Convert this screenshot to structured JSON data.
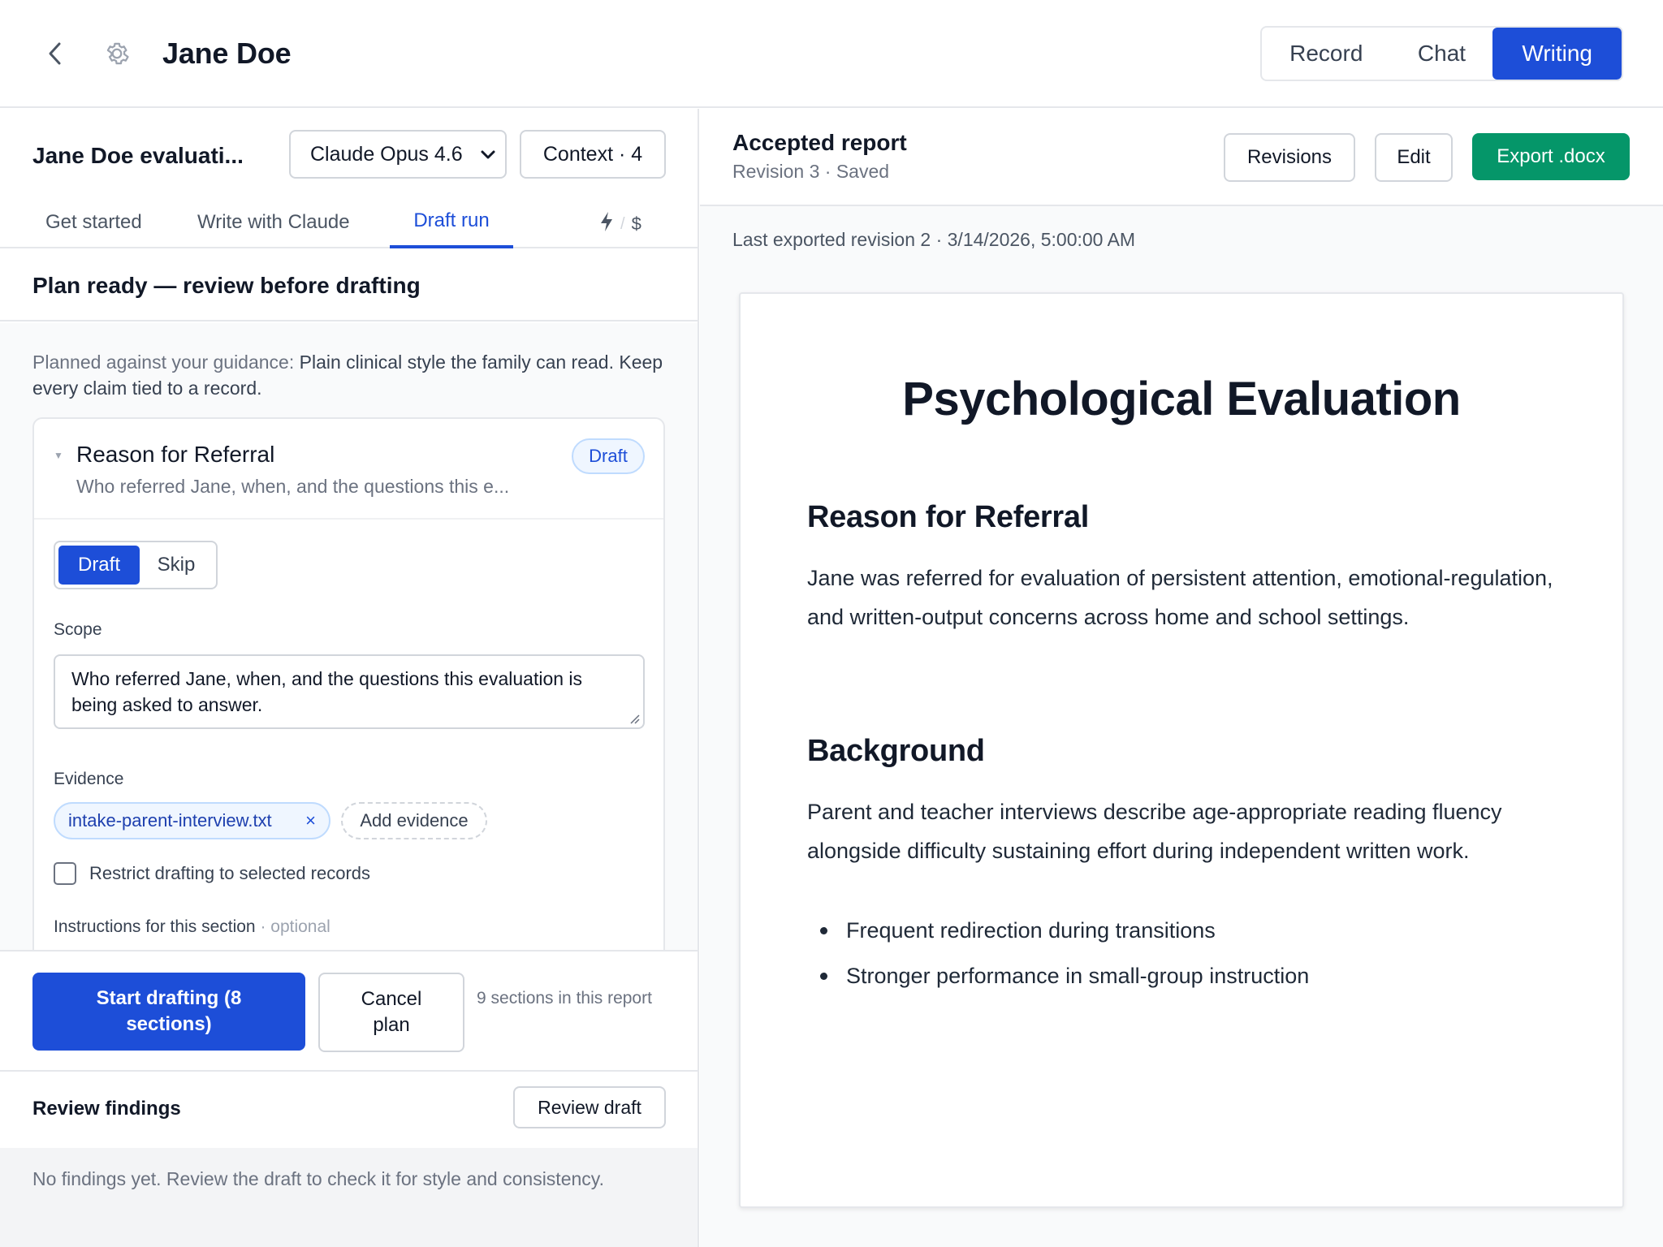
{
  "header": {
    "title": "Jane Doe",
    "modes": {
      "record": "Record",
      "chat": "Chat",
      "writing": "Writing"
    },
    "active_mode": "Writing",
    "accent": "#1d4ed8"
  },
  "left": {
    "doc_name": "Jane Doe evaluati...",
    "model_select": {
      "value": "Claude Opus 4.6",
      "icon": "chevron-down-icon"
    },
    "context_button": "Context · 4",
    "tabs": [
      {
        "label": "Get started"
      },
      {
        "label": "Write with Claude"
      },
      {
        "label": "Draft run",
        "active": true
      }
    ],
    "tab_tools": {
      "bolt_icon": "bolt-icon",
      "separator": "/",
      "cost_symbol": "$"
    },
    "plan_title": "Plan ready — review before drafting",
    "guidance": {
      "label": "Planned against your guidance:",
      "text": " Plain clinical style the family can read. Keep every claim tied to a record."
    },
    "section": {
      "title": "Reason for Referral",
      "subtitle": "Who referred Jane, when, and the questions this e...",
      "badge": "Draft",
      "toggle": {
        "draft": "Draft",
        "skip": "Skip",
        "selected": "Draft"
      },
      "scope_label": "Scope",
      "scope_value": "Who referred Jane, when, and the questions this evaluation is being asked to answer.",
      "evidence_label": "Evidence",
      "evidence_chips": [
        {
          "name": "intake-parent-interview.txt",
          "remove": "×"
        }
      ],
      "add_evidence": "Add evidence",
      "restrict_label": "Restrict drafting to selected records",
      "restrict_checked": false,
      "instructions_label": "Instructions for this section",
      "instructions_optional": " · optional"
    },
    "actions": {
      "start": "Start drafting (8 sections)",
      "cancel": "Cancel plan",
      "note": "9 sections in this report"
    },
    "findings": {
      "title": "Review findings",
      "review_button": "Review draft",
      "empty_text": "No findings yet. Review the draft to check it for style and consistency."
    }
  },
  "right": {
    "title": "Accepted report",
    "subtitle": "Revision 3 · Saved",
    "buttons": {
      "revisions": "Revisions",
      "edit": "Edit",
      "export": "Export .docx"
    },
    "export_color": "#059669",
    "last_exported": "Last exported revision 2 · 3/14/2026, 5:00:00 AM",
    "document": {
      "title": "Psychological Evaluation",
      "sections": [
        {
          "heading": "Reason for Referral",
          "body": "Jane was referred for evaluation of persistent attention, emotional-regulation, and written-output concerns across home and school settings."
        },
        {
          "heading": "Background",
          "body": "Parent and teacher interviews describe age-appropriate reading fluency alongside difficulty sustaining effort during independent written work.",
          "bullets": [
            "Frequent redirection during transitions",
            "Stronger performance in small-group instruction"
          ]
        }
      ]
    }
  }
}
